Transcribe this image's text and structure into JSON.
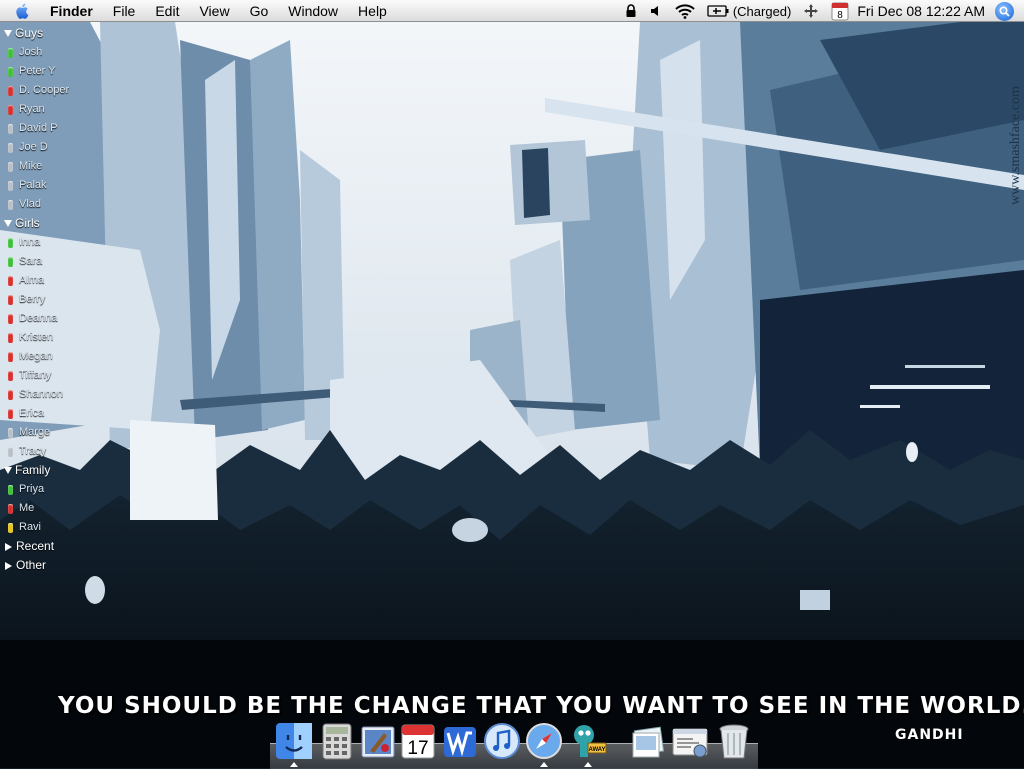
{
  "menubar": {
    "app_name": "Finder",
    "menus": [
      "File",
      "Edit",
      "View",
      "Go",
      "Window",
      "Help"
    ],
    "battery_status": "(Charged)",
    "calendar_day": "8",
    "clock": "Fri Dec 08  12:22 AM"
  },
  "buddy_list": {
    "groups": [
      {
        "name": "Guys",
        "expanded": true,
        "buddies": [
          {
            "name": "Josh",
            "status": "green"
          },
          {
            "name": "Peter Y",
            "status": "green"
          },
          {
            "name": "D. Cooper",
            "status": "red"
          },
          {
            "name": "Ryan",
            "status": "red"
          },
          {
            "name": "David P",
            "status": "gray"
          },
          {
            "name": "Joe D",
            "status": "gray"
          },
          {
            "name": "Mike",
            "status": "gray"
          },
          {
            "name": "Palak",
            "status": "gray"
          },
          {
            "name": "Vlad",
            "status": "gray"
          }
        ]
      },
      {
        "name": "Girls",
        "expanded": true,
        "buddies": [
          {
            "name": "Inna",
            "status": "green"
          },
          {
            "name": "Sara",
            "status": "green"
          },
          {
            "name": "Alma",
            "status": "red"
          },
          {
            "name": "Berry",
            "status": "red"
          },
          {
            "name": "Deanna",
            "status": "red"
          },
          {
            "name": "Kristen",
            "status": "red"
          },
          {
            "name": "Megan",
            "status": "red"
          },
          {
            "name": "Tiffany",
            "status": "red"
          },
          {
            "name": "Shannon",
            "status": "red"
          },
          {
            "name": "Erica",
            "status": "red"
          },
          {
            "name": "Marge",
            "status": "gray"
          },
          {
            "name": "Tracy",
            "status": "gray"
          }
        ]
      },
      {
        "name": "Family",
        "expanded": true,
        "buddies": [
          {
            "name": "Priya",
            "status": "green"
          },
          {
            "name": "Me",
            "status": "red"
          },
          {
            "name": "Ravi",
            "status": "yellow"
          }
        ]
      },
      {
        "name": "Recent",
        "expanded": false,
        "buddies": []
      },
      {
        "name": "Other",
        "expanded": false,
        "buddies": []
      }
    ],
    "status_colors": {
      "green": "#3fc23a",
      "red": "#d8322f",
      "yellow": "#e7c51d",
      "gray": "#b9c0c8"
    }
  },
  "wallpaper": {
    "quote": "YOU SHOULD BE THE CHANGE THAT YOU WANT TO SEE IN THE WORLD.",
    "author": "GANDHI",
    "watermark": "www.smashface.com",
    "palette": {
      "sky": "#e9eef3",
      "light": "#9cb6cc",
      "mid": "#5d7f9d",
      "dark": "#1e3347",
      "crowd": "#070d14"
    }
  },
  "dock": {
    "items": [
      {
        "name": "Finder",
        "icon": "finder-icon",
        "running": true
      },
      {
        "name": "Calculator",
        "icon": "calculator-icon",
        "running": false
      },
      {
        "name": "Mail",
        "icon": "mail-icon",
        "running": false
      },
      {
        "name": "iCal",
        "icon": "ical-icon",
        "running": false,
        "label": "17"
      },
      {
        "name": "Word",
        "icon": "word-icon",
        "running": false
      },
      {
        "name": "iTunes",
        "icon": "itunes-icon",
        "running": false
      },
      {
        "name": "Safari",
        "icon": "safari-icon",
        "running": true
      },
      {
        "name": "Adium",
        "icon": "adium-icon",
        "running": true,
        "label": "AWAY"
      },
      {
        "name": "Preview",
        "icon": "preview-icon",
        "running": false
      },
      {
        "name": "System Profiler",
        "icon": "system-profiler-icon",
        "running": false
      },
      {
        "name": "Trash",
        "icon": "trash-icon",
        "running": false
      }
    ]
  }
}
